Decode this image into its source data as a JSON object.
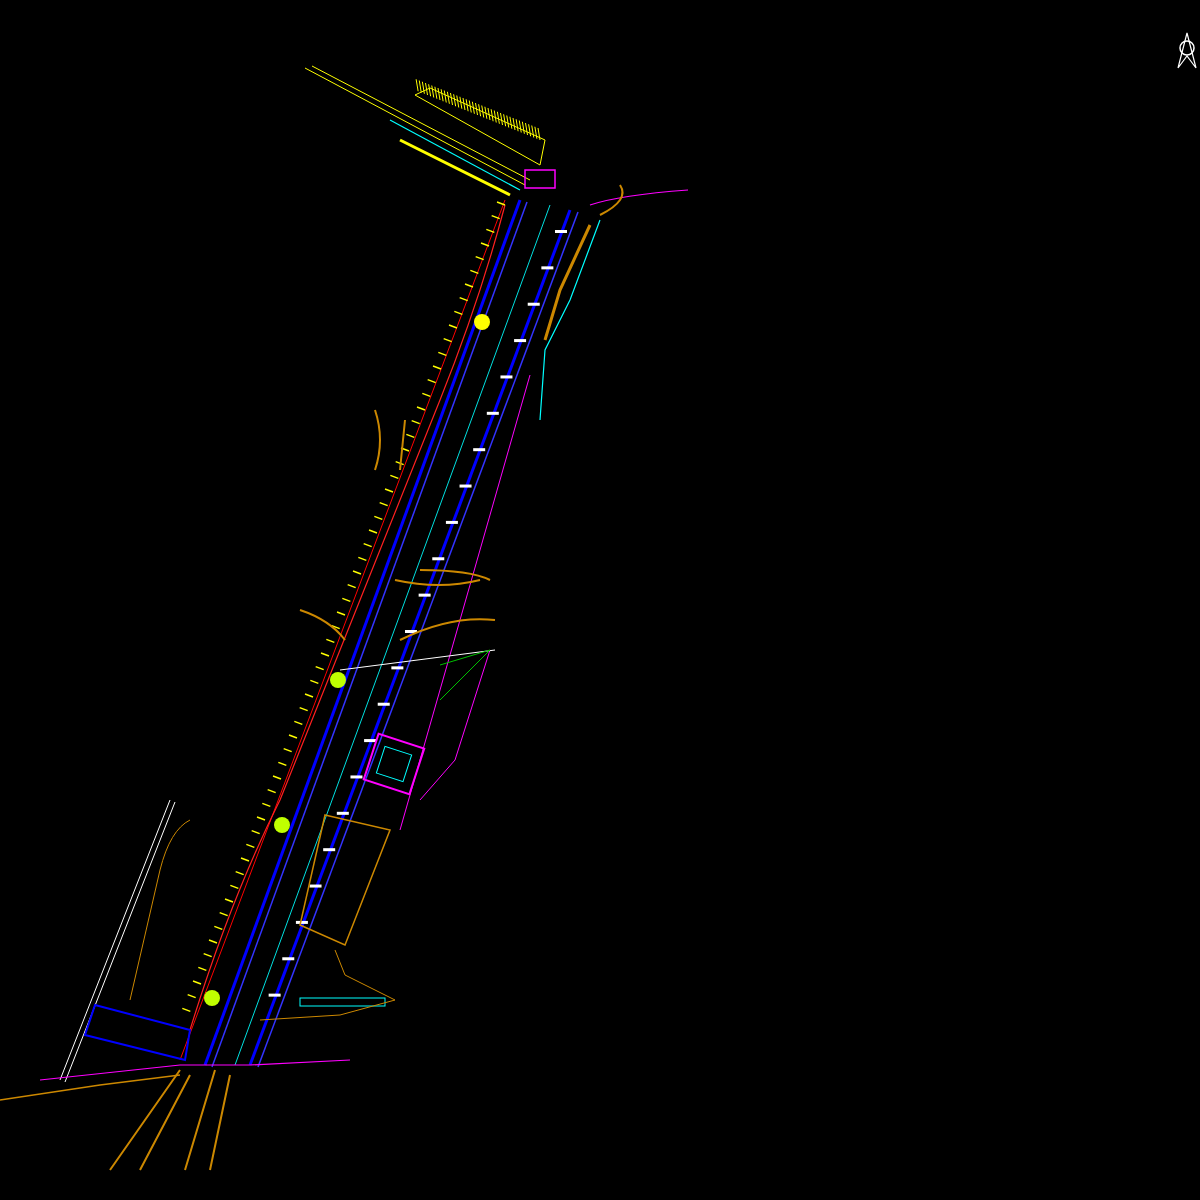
{
  "drawing": {
    "kind": "site-plan",
    "north_arrow": true
  }
}
